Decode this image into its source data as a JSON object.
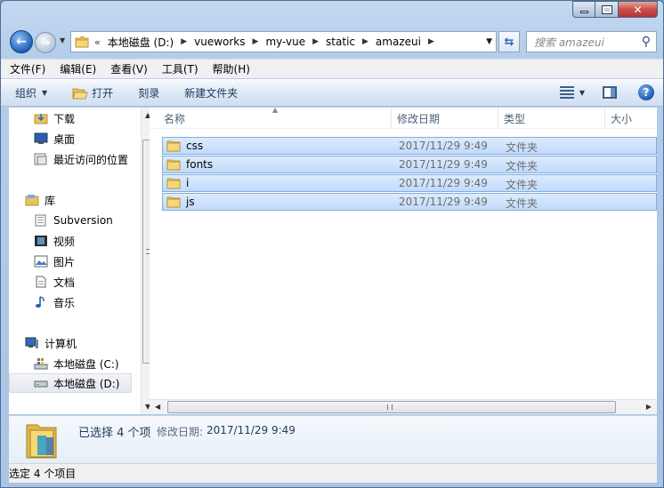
{
  "address": {
    "overflow": "«",
    "crumbs": [
      "本地磁盘 (D:)",
      "vueworks",
      "my-vue",
      "static",
      "amazeui"
    ]
  },
  "search": {
    "placeholder": "搜索 amazeui"
  },
  "menubar": {
    "items": [
      "文件(F)",
      "编辑(E)",
      "查看(V)",
      "工具(T)",
      "帮助(H)"
    ]
  },
  "toolbar": {
    "organize": "组织",
    "open": "打开",
    "burn": "刻录",
    "new_folder": "新建文件夹"
  },
  "nav": {
    "favorites": [
      {
        "label": "下载",
        "icon": "download-folder-icon"
      },
      {
        "label": "桌面",
        "icon": "desktop-icon"
      },
      {
        "label": "最近访问的位置",
        "icon": "recent-places-icon"
      }
    ],
    "libraries_label": "库",
    "libraries": [
      {
        "label": "Subversion",
        "icon": "library-icon"
      },
      {
        "label": "视频",
        "icon": "video-library-icon"
      },
      {
        "label": "图片",
        "icon": "picture-library-icon"
      },
      {
        "label": "文档",
        "icon": "document-library-icon"
      },
      {
        "label": "音乐",
        "icon": "music-library-icon"
      }
    ],
    "computer_label": "计算机",
    "drives": [
      {
        "label": "本地磁盘 (C:)",
        "icon": "system-drive-icon"
      },
      {
        "label": "本地磁盘 (D:)",
        "icon": "drive-icon"
      }
    ]
  },
  "columns": {
    "name": "名称",
    "modified": "修改日期",
    "type": "类型",
    "size": "大小"
  },
  "files": [
    {
      "name": "css",
      "modified": "2017/11/29 9:49",
      "type": "文件夹"
    },
    {
      "name": "fonts",
      "modified": "2017/11/29 9:49",
      "type": "文件夹"
    },
    {
      "name": "i",
      "modified": "2017/11/29 9:49",
      "type": "文件夹"
    },
    {
      "name": "js",
      "modified": "2017/11/29 9:49",
      "type": "文件夹"
    }
  ],
  "details": {
    "count": "已选择 4 个项",
    "modified_label": "修改日期:",
    "modified_value": "2017/11/29 9:49"
  },
  "status": {
    "text": "选定 4 个项目"
  },
  "colors": {
    "selection": "#cce4fc",
    "selection_border": "#84acdd",
    "folder": "#e8c460"
  }
}
